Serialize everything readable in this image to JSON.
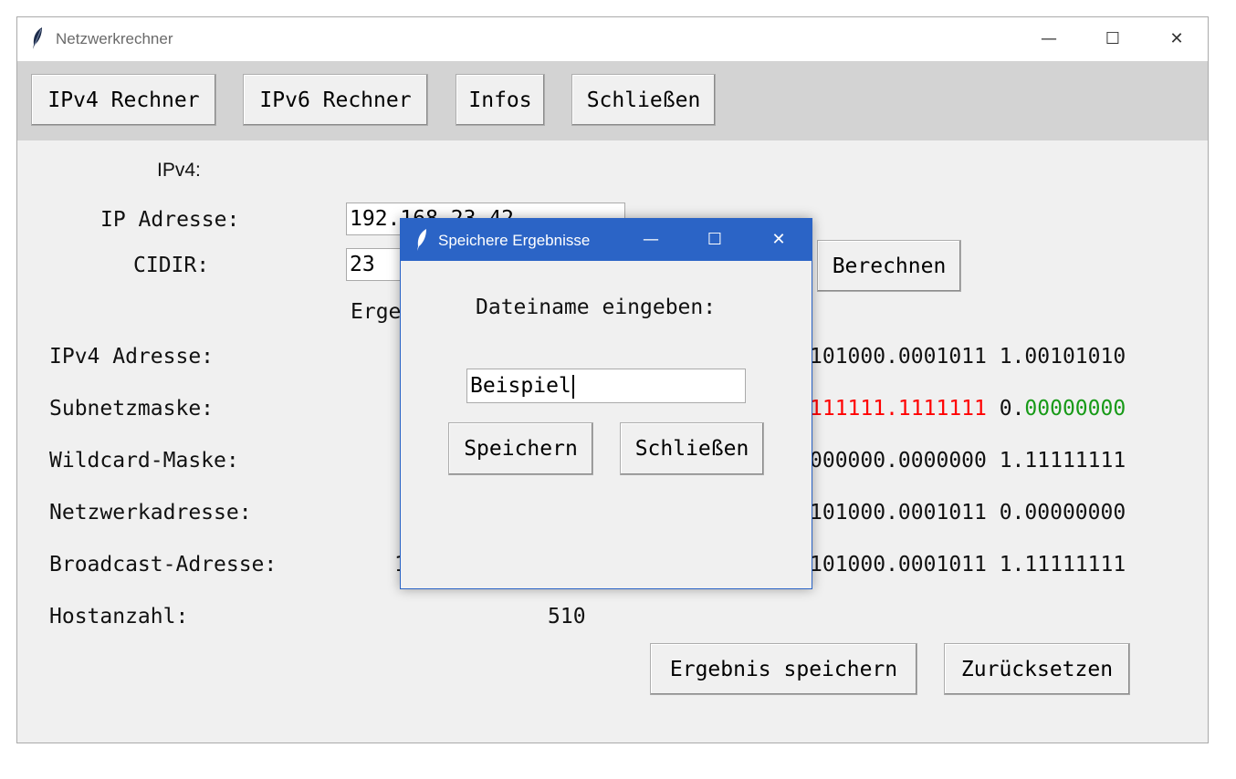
{
  "window": {
    "title": "Netzwerkrechner",
    "controls": {
      "minimize": "—",
      "maximize": "☐",
      "close": "✕"
    }
  },
  "toolbar": {
    "ipv4": "IPv4 Rechner",
    "ipv6": "IPv6 Rechner",
    "infos": "Infos",
    "close": "Schließen"
  },
  "form": {
    "section_label": "IPv4:",
    "ip_label": "IP Adresse:",
    "ip_value": "192.168.23.42",
    "cidr_label": "CIDIR:",
    "cidr_value": "23",
    "calc_button": "Berechnen",
    "results_header": "Erge"
  },
  "results": {
    "rows": [
      {
        "label": "IPv4 Adresse:",
        "visible_value": "101000.0001011 1.00101010"
      },
      {
        "label": "Subnetzmaske:",
        "visible_value_red": "111111.1111111",
        "visible_value_sep": " 0.",
        "visible_value_green": "00000000"
      },
      {
        "label": "Wildcard-Maske:",
        "visible_value": "000000.0000000 1.11111111"
      },
      {
        "label": "Netzwerkadresse:",
        "visible_value": "101000.0001011 0.00000000"
      },
      {
        "label": "Broadcast-Adresse:",
        "partial": "1",
        "visible_value": "101000.0001011 1.11111111"
      },
      {
        "label": "Hostanzahl:",
        "visible_value": "510"
      }
    ],
    "save_button": "Ergebnis speichern",
    "reset_button": "Zurücksetzen"
  },
  "dialog": {
    "title": "Speichere Ergebnisse",
    "prompt": "Dateiname eingeben:",
    "filename_value": "Beispiel",
    "save_button": "Speichern",
    "close_button": "Schließen",
    "controls": {
      "minimize": "—",
      "maximize": "☐",
      "close": "✕"
    }
  },
  "colors": {
    "dialog_accent": "#2b64c6",
    "mask_ones": "#ff0000",
    "mask_zeros": "#179a17"
  }
}
